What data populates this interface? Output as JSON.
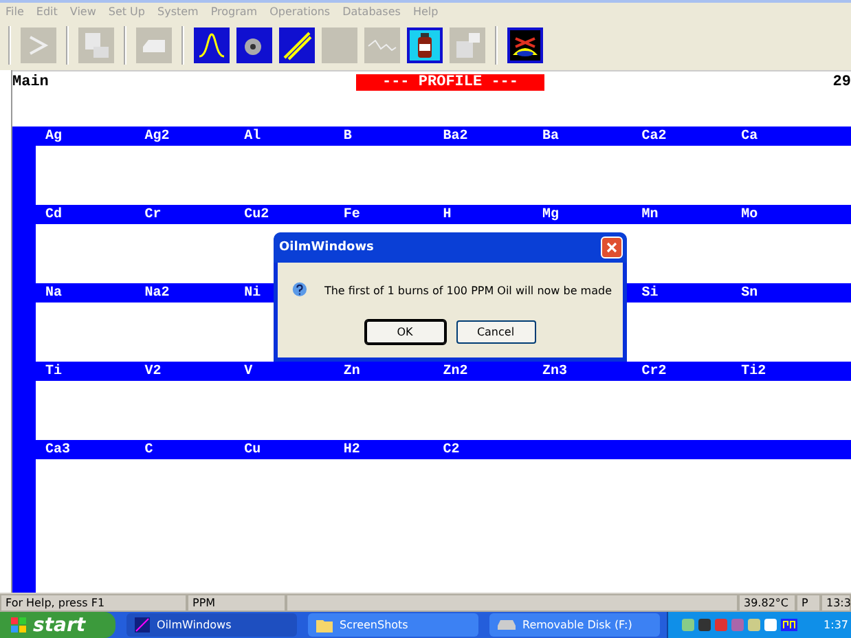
{
  "menu": [
    "File",
    "Edit",
    "View",
    "Set Up",
    "System",
    "Program",
    "Operations",
    "Databases",
    "Help"
  ],
  "toolbar": [
    {
      "kind": "prompt",
      "disabled": true
    },
    {
      "kind": "report",
      "disabled": true
    },
    {
      "kind": "print",
      "disabled": true
    },
    {
      "kind": "peak",
      "disabled": false
    },
    {
      "kind": "disk",
      "disabled": false
    },
    {
      "kind": "calibrate",
      "disabled": false
    },
    {
      "kind": "blank",
      "disabled": true
    },
    {
      "kind": "graph",
      "disabled": true
    },
    {
      "kind": "bottle",
      "disabled": false
    },
    {
      "kind": "computer",
      "disabled": true
    },
    {
      "kind": "machine",
      "disabled": false
    }
  ],
  "header": {
    "title": "Main",
    "mode": "--- PROFILE ---",
    "count": "29"
  },
  "element_rows": [
    [
      "Ag",
      "Ag2",
      "Al",
      "B",
      "Ba2",
      "Ba",
      "Ca2",
      "Ca"
    ],
    [
      "Cd",
      "Cr",
      "Cu2",
      "Fe",
      "H",
      "Mg",
      "Mn",
      "Mo"
    ],
    [
      "Na",
      "Na2",
      "Ni",
      "",
      "",
      "",
      "Si",
      "Sn"
    ],
    [
      "Ti",
      "V2",
      "V",
      "Zn",
      "Zn2",
      "Zn3",
      "Cr2",
      "Ti2"
    ],
    [
      "Ca3",
      "C",
      "Cu",
      "H2",
      "C2"
    ]
  ],
  "dialog": {
    "title": "OilmWindows",
    "message": "The first of 1 burns of 100 PPM Oil will now be made",
    "buttons": [
      {
        "label": "OK",
        "selected": true
      },
      {
        "label": "Cancel",
        "selected": false
      }
    ]
  },
  "status_bar": {
    "help": "For Help, press F1",
    "units": "PPM",
    "temperature": "39.82°C",
    "mode": "P",
    "time": "13:3"
  },
  "taskbar": {
    "start": "start",
    "tasks": [
      {
        "label": "OilmWindows",
        "selected": true,
        "kind": "app"
      },
      {
        "label": "ScreenShots",
        "selected": false,
        "kind": "folder"
      },
      {
        "label": "Removable Disk (F:)",
        "selected": false,
        "kind": "drive"
      }
    ],
    "clock": "1:37"
  }
}
